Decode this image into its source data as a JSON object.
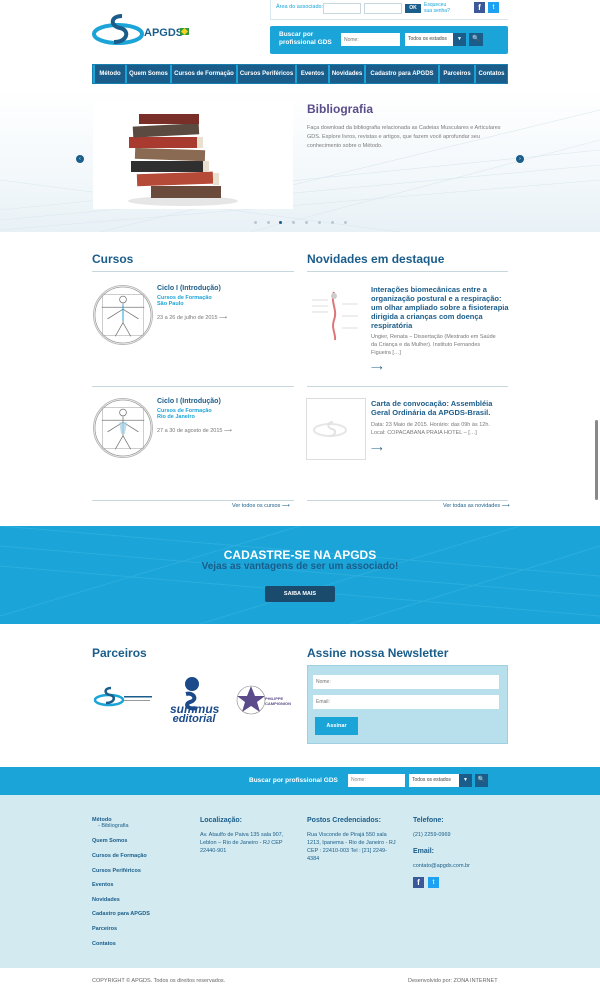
{
  "header": {
    "logo_text": "APGDS",
    "assoc_label": "Área do associado:",
    "assoc_ok": "OK",
    "assoc_forgot": "Esqueceu sua senha?",
    "fb_icon": "f",
    "tw_icon": "t",
    "search_label": "Buscar por profissional GDS",
    "search_placeholder": "Nome:",
    "search_select": "Todos os estados",
    "select_arrow": "▼",
    "search_go": "🔍"
  },
  "nav": {
    "items": [
      "Método",
      "Quem Somos",
      "Cursos de Formação",
      "Cursos Periféricos",
      "Eventos",
      "Novidades",
      "Cadastro para APGDS",
      "Parceiros",
      "Contatos"
    ]
  },
  "slider": {
    "title": "Bibliografia",
    "text": "Faça download da bibliografia relacionada as Cadeias Musculares e Articulares GDS. Explore livros, revistas e artigos, que fazem você aprofundar seu conhecimento sobre o Método.",
    "prev": "‹",
    "next": "›",
    "dots_total": 8,
    "dot_active": 3
  },
  "cursos": {
    "title": "Cursos",
    "items": [
      {
        "title": "Ciclo I (Introdução)",
        "cat1": "Cursos de Formação",
        "cat2": "São Paulo",
        "date": "23 a 26 de julho de 2015 ⟶"
      },
      {
        "title": "Ciclo I (Introdução)",
        "cat1": "Cursos de Formação",
        "cat2": "Rio de Janeiro",
        "date": "27 a 30 de agosto de 2015 ⟶"
      }
    ],
    "see_all": "Ver todos os cursos ⟶"
  },
  "novidades": {
    "title": "Novidades em destaque",
    "items": [
      {
        "title": "Interações biomecânicas entre a organização postural e a respiração: um olhar ampliado sobre a fisioterapia dirigida a crianças com doença respiratória",
        "text": "Ungier, Renata – Dissertação (Mestrado em Saúde da Criança e da Mulher). Instituto Fernandes Figueira […]",
        "arrow": "⟶"
      },
      {
        "title": "Carta de convocação: Assembléia Geral Ordinária da APGDS-Brasil.",
        "text": "Data: 23 Maio de 2015. Horário: das 09h às 12h. Local: COPACABANA PRAIA HOTEL – […]",
        "arrow": "⟶"
      }
    ],
    "see_all": "Ver todas as novidades ⟶"
  },
  "banner": {
    "title": "CADASTRE-SE NA APGDS",
    "subtitle": "Vejas as vantagens de ser um associado!",
    "button": "SAIBA MAIS"
  },
  "parceiros": {
    "title": "Parceiros",
    "logo2_line1": "summus",
    "logo2_line2": "editorial",
    "logo3_text": "PHILIPPE CAMPIGNION"
  },
  "newsletter": {
    "title": "Assine nossa Newsletter",
    "name_placeholder": "Nome:",
    "email_placeholder": "Email:",
    "button": "Assinar"
  },
  "bottom_search": {
    "label": "Buscar por profissional GDS",
    "placeholder": "Nome:",
    "select": "Todos os estados"
  },
  "footer": {
    "menu": [
      "Método",
      "Quem Somos",
      "Cursos de Formação",
      "Cursos Periféricos",
      "Eventos",
      "Novidades",
      "Cadastro para APGDS",
      "Parceiros",
      "Contatos"
    ],
    "submenu": "- Bibliografia",
    "loc_title": "Localização:",
    "loc_text": "Av. Ataulfo de Paiva 135 sala 907, Leblon – Rio de Janeiro - RJ CEP 22440-901",
    "postos_title": "Postos Credenciados:",
    "postos_text": "Rua Visconde de Pirajá 550 sala 1213, Ipanema - Rio de Janeiro - RJ CEP : 22410-003 Tel : [21] 2249-4384",
    "tel_title": "Telefone:",
    "tel_text": "(21) 2259-0969",
    "email_title": "Email:",
    "email_text": "contato@apgds.com.br",
    "copyright": "COPYRIGHT © APGDS. Todos os direitos reservados.",
    "dev": "Desenvolvido por: ZONA INTERNET"
  }
}
